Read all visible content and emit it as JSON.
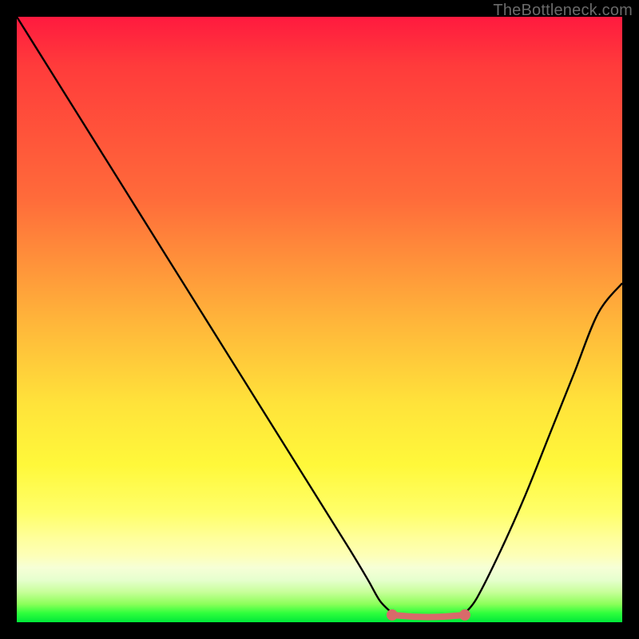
{
  "attribution": "TheBottleneck.com",
  "colors": {
    "background": "#000000",
    "curve_stroke": "#000000",
    "flat_segment": "#d86a6a",
    "flat_endpoint_fill": "#d86a6a",
    "attribution_text": "#6a6a6a"
  },
  "chart_data": {
    "type": "line",
    "title": "",
    "xlabel": "",
    "ylabel": "",
    "xlim": [
      0,
      100
    ],
    "ylim": [
      0,
      100
    ],
    "grid": false,
    "legend": false,
    "series": [
      {
        "name": "bottleneck-curve-left",
        "x": [
          0,
          5,
          10,
          15,
          20,
          25,
          30,
          35,
          40,
          45,
          50,
          55,
          58,
          60,
          62
        ],
        "y": [
          100,
          92,
          84,
          76,
          68,
          60,
          52,
          44,
          36,
          28,
          20,
          12,
          7,
          3.5,
          1.5
        ]
      },
      {
        "name": "bottleneck-curve-right",
        "x": [
          74,
          76,
          80,
          84,
          88,
          92,
          96,
          100
        ],
        "y": [
          1.5,
          4,
          12,
          21,
          31,
          41,
          51,
          56
        ]
      },
      {
        "name": "flat-optimal-segment",
        "x": [
          62,
          66,
          70,
          74
        ],
        "y": [
          1.2,
          0.9,
          0.9,
          1.2
        ]
      }
    ],
    "annotations": [
      {
        "name": "flat-left-endpoint",
        "x": 62,
        "y": 1.2
      },
      {
        "name": "flat-right-endpoint",
        "x": 74,
        "y": 1.2
      }
    ]
  }
}
